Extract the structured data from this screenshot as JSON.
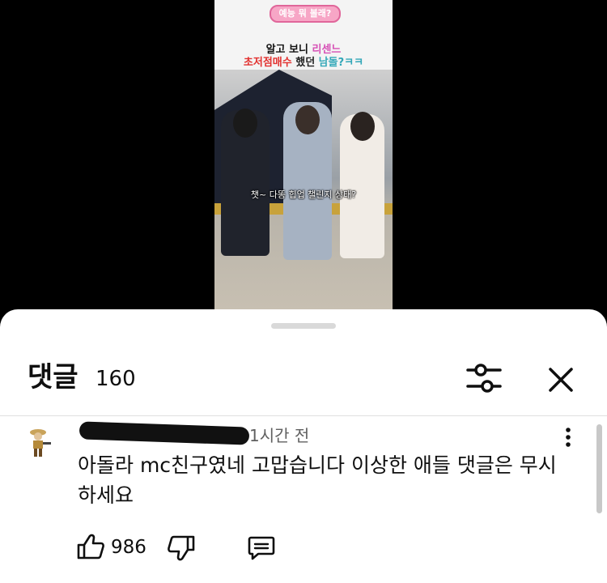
{
  "video": {
    "tag": "예능 뭐 볼래?",
    "headline_line1_a": "알고 보니 ",
    "headline_line1_b": "리센느",
    "headline_line2_a": "초저점매수 ",
    "headline_line2_b": "했던 ",
    "headline_line2_c": "남돌?ㅋㅋ",
    "caption": "챗~ 다똥 힙업 챌린지 상태?"
  },
  "comments_panel": {
    "title": "댓글",
    "count": "160",
    "filter_icon": "sliders-icon",
    "close_icon": "close-icon"
  },
  "comment": {
    "time": "1시간 전",
    "text": "아돌라 mc친구였네 고맙습니다 이상한 애들 댓글은 무시하세요",
    "likes": "986",
    "more_icon": "more-vertical-icon",
    "like_icon": "thumbs-up-icon",
    "dislike_icon": "thumbs-down-icon",
    "reply_icon": "reply-icon"
  }
}
